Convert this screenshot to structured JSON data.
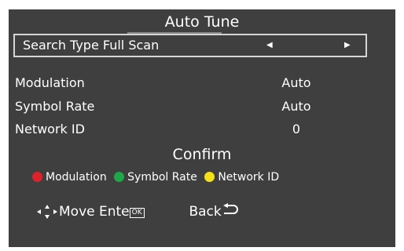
{
  "menu": {
    "title": "Auto Tune",
    "search": {
      "label": "Search Type Full Scan"
    },
    "params": [
      {
        "label": "Modulation",
        "value": "Auto"
      },
      {
        "label": "Symbol Rate",
        "value": "Auto"
      },
      {
        "label": "Network ID",
        "value": "0"
      }
    ],
    "confirm_label": "Confirm",
    "legend": [
      {
        "label": "Modulation",
        "color": "#e0202a"
      },
      {
        "label": "Symbol Rate",
        "color": "#1fa84a"
      },
      {
        "label": "Network ID",
        "color": "#f5e01a"
      }
    ],
    "nav": {
      "move_label": "Move",
      "enter_label": "Ente",
      "ok_label": "OK",
      "back_label": "Back"
    }
  },
  "colors": {
    "screen_bg": "#3f3f3f",
    "text": "#ffffff",
    "border": "#d6d6d6"
  },
  "icons": [
    "arrow-left-icon",
    "arrow-right-icon",
    "dpad-icon",
    "ok-key-icon",
    "back-icon"
  ]
}
